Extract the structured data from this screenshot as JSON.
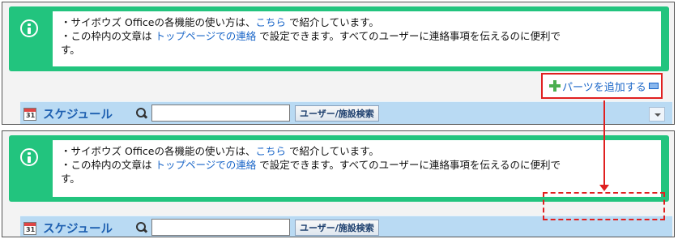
{
  "notice": {
    "line1_prefix": "・サイボウズ Officeの各機能の使い方は、",
    "line1_link": "こちら",
    "line1_suffix": " で紹介しています。",
    "line2_prefix": "・この枠内の文章は ",
    "line2_link": "トップページでの連絡",
    "line2_suffix": " で設定できます。すべてのユーザーに連絡事項を伝えるのに便利で",
    "line3": "す。"
  },
  "add_parts": {
    "label": "パーツを追加する"
  },
  "schedule": {
    "title": "スケジュール",
    "calendar_number": "31",
    "search_value": "",
    "search_button": "ユーザー/施設検索"
  },
  "colors": {
    "notice_green": "#22c47e",
    "bar_blue": "#b9daf3",
    "link_blue": "#1a66c8",
    "highlight_red": "#e02020"
  },
  "icons": [
    "info-icon",
    "plus-icon",
    "minus-icon",
    "calendar-icon",
    "search-icon",
    "chevron-down-icon"
  ]
}
